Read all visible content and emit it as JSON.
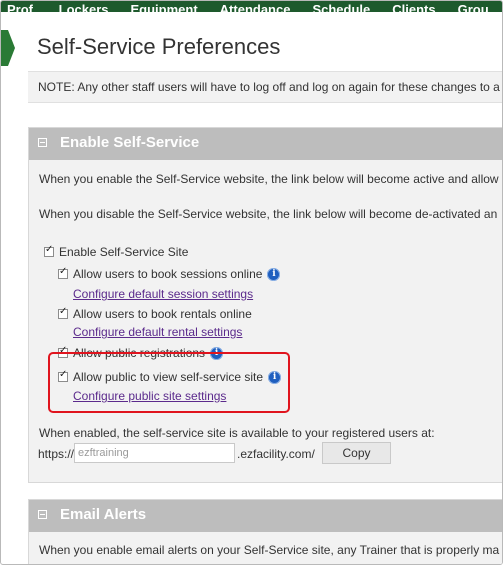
{
  "nav": {
    "items": [
      "Prof.",
      "Lockers",
      "Equipment",
      "Attendance",
      "Schedule",
      "Clients",
      "Grou"
    ]
  },
  "page": {
    "title": "Self-Service Preferences",
    "note": "NOTE: Any other staff users will have to log off and log on again for these changes to a"
  },
  "enable_section": {
    "title": "Enable Self-Service",
    "enable_para": "When you enable the Self-Service website, the link below will become active and allow",
    "disable_para": "When you disable the Self-Service website, the link below will become de-activated an",
    "enable_site_label": "Enable Self-Service Site",
    "book_sessions_label": "Allow users to book sessions online",
    "configure_session_link": "Configure default session settings",
    "book_rentals_label": "Allow users to book rentals online",
    "configure_rental_link": "Configure default rental settings",
    "public_registrations_label": "Allow public registrations",
    "public_view_label": "Allow public to view self-service site",
    "configure_public_link": "Configure public site settings",
    "enabled_note": "When enabled, the self-service site is available to your registered users at:",
    "url_prefix": "https://",
    "url_placeholder": "ezftraining",
    "url_suffix": ".ezfacility.com/",
    "copy_label": "Copy"
  },
  "email_section": {
    "title": "Email Alerts",
    "para": "When you enable email alerts on your Self-Service site, any Trainer that is properly ma"
  },
  "icons": {
    "info": "info-icon",
    "collapse": "collapse-minus-icon"
  },
  "colors": {
    "nav_bg": "#1e5a2d",
    "section_header_bg": "#bdbdbd",
    "link": "#5b2a8c",
    "highlight": "#e0141e",
    "info_icon": "#1f5fbf"
  }
}
